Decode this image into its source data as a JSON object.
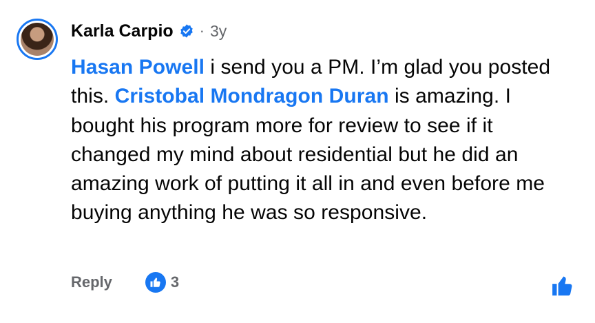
{
  "comment": {
    "author": "Karla Carpio",
    "timestamp": "3y",
    "separator": "·",
    "verified": true,
    "text_parts": [
      {
        "type": "mention",
        "text": "Hasan Powell"
      },
      {
        "type": "text",
        "text": " i send you a PM. I’m glad you posted this. "
      },
      {
        "type": "mention",
        "text": "Cristobal Mondragon Duran"
      },
      {
        "type": "text",
        "text": " is amazing. I bought his program more for review to see if it changed my mind about residential but he did an amazing work of putting it all in and even before me buying anything he was so responsive."
      }
    ]
  },
  "actions": {
    "reply_label": "Reply",
    "reaction_count": "3"
  },
  "icons": {
    "verified": "verified-badge-icon",
    "reaction": "like-reaction-icon",
    "like_button": "thumbs-up-icon"
  },
  "colors": {
    "accent": "#1877F2",
    "secondary_text": "#65676B",
    "primary_text": "#050505"
  }
}
